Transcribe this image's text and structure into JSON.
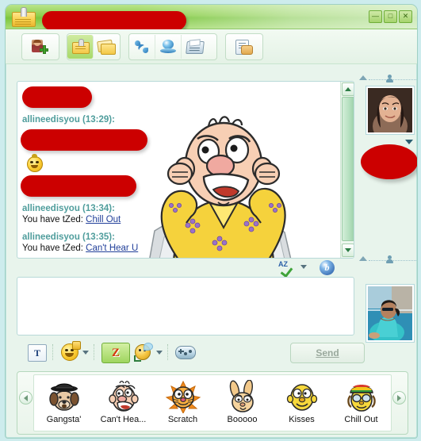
{
  "window": {
    "title_redacted": true,
    "icon": "nametag-icon",
    "controls": {
      "minimize": "—",
      "maximize": "□",
      "close": "✕"
    }
  },
  "toolbar": {
    "buttons": [
      {
        "name": "invite-someone",
        "icon": "person-plus-icon",
        "active": false
      },
      {
        "name": "nametag",
        "icon": "nametag-icon",
        "active": true
      },
      {
        "name": "notes",
        "icon": "notes-icon",
        "active": false
      },
      {
        "name": "voice-call",
        "icon": "phone-icon",
        "active": false
      },
      {
        "name": "video-call",
        "icon": "webcam-icon",
        "active": false
      },
      {
        "name": "activities",
        "icon": "fax-icon",
        "active": false
      },
      {
        "name": "send-file",
        "icon": "send-file-icon",
        "active": false
      }
    ]
  },
  "chat": {
    "messages": [
      {
        "type": "redacted",
        "sender": "",
        "time": "",
        "text": ""
      },
      {
        "type": "text",
        "header": "allineedisyou (13:29):",
        "body": "",
        "redacted": true
      },
      {
        "type": "emoticon",
        "icon": "smiley-emoticon"
      },
      {
        "type": "redacted"
      },
      {
        "type": "text",
        "header": "allineedisyou (13:34):",
        "prefix": "You have tZed: ",
        "link": "Chill Out"
      },
      {
        "type": "text",
        "header": "allineedisyou (13:35):",
        "prefix": "You have tZed: ",
        "link": "Can't Hear U"
      }
    ],
    "headers": {
      "h1": "allineedisyou (13:29):",
      "h2": "allineedisyou (13:34):",
      "h3": "allineedisyou (13:35):"
    },
    "bodies": {
      "b2_prefix": "You have tZed: ",
      "b2_link": "Chill Out",
      "b3_prefix": "You have tZed: ",
      "b3_link": "Can't Hear U"
    },
    "wink_overlay": "cant-hear-u-wink-animation"
  },
  "spell_row": {
    "spellcheck_label": "AZ",
    "bing_label": "b"
  },
  "input": {
    "value": "",
    "placeholder": ""
  },
  "bottom_toolbar": {
    "font_label": "T",
    "nudge_label": "Z",
    "send_label": "Send",
    "send_enabled": false,
    "icons": [
      "font-icon",
      "emoticon-icon",
      "nudge-icon",
      "winks-icon",
      "games-icon"
    ]
  },
  "tray": {
    "items": [
      {
        "label": "Gangsta'",
        "icon": "gangsta-dog-face"
      },
      {
        "label": "Can't Hea...",
        "icon": "cant-hear-u-face"
      },
      {
        "label": "Scratch",
        "icon": "scratch-cat-face"
      },
      {
        "label": "Booooo",
        "icon": "booooo-rabbit-face"
      },
      {
        "label": "Kisses",
        "icon": "kisses-face"
      },
      {
        "label": "Chill Out",
        "icon": "chill-out-face"
      }
    ],
    "scroll_left": "◄",
    "scroll_right": "►"
  },
  "sidebar": {
    "contact_photo": "contact-display-picture",
    "contact_name_redacted": true,
    "self_photo": "self-display-picture"
  },
  "colors": {
    "titlebar_green": "#8fd04f",
    "accent_green": "#a8d96a",
    "window_bg": "#e8f4ec",
    "desktop_bg": "#cdeced",
    "redaction_red": "#cc0000",
    "sender_teal": "#4f9d9c",
    "link_blue": "#22409a"
  }
}
